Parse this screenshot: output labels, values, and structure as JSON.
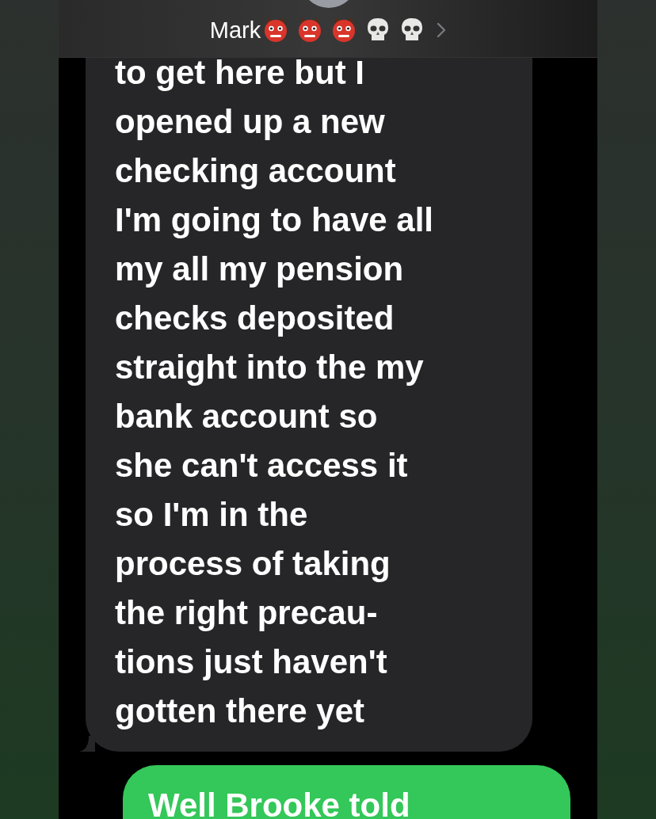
{
  "header": {
    "contact_name": "Mark",
    "emojis": [
      {
        "kind": "ogre"
      },
      {
        "kind": "ogre"
      },
      {
        "kind": "ogre"
      },
      {
        "kind": "skull"
      },
      {
        "kind": "skull"
      }
    ]
  },
  "messages": [
    {
      "kind": "received",
      "lines": [
        "to get here but I",
        "opened up a new",
        "checking account",
        "I'm going to have all",
        "my all my pension",
        "checks deposited",
        "straight into the my",
        "bank account so",
        "she can't access it",
        "so I'm in the",
        "process of taking",
        "the right precau-",
        "tions just haven't",
        "gotten there yet"
      ]
    },
    {
      "kind": "sent",
      "lines": [
        "Well Brooke told"
      ]
    }
  ]
}
